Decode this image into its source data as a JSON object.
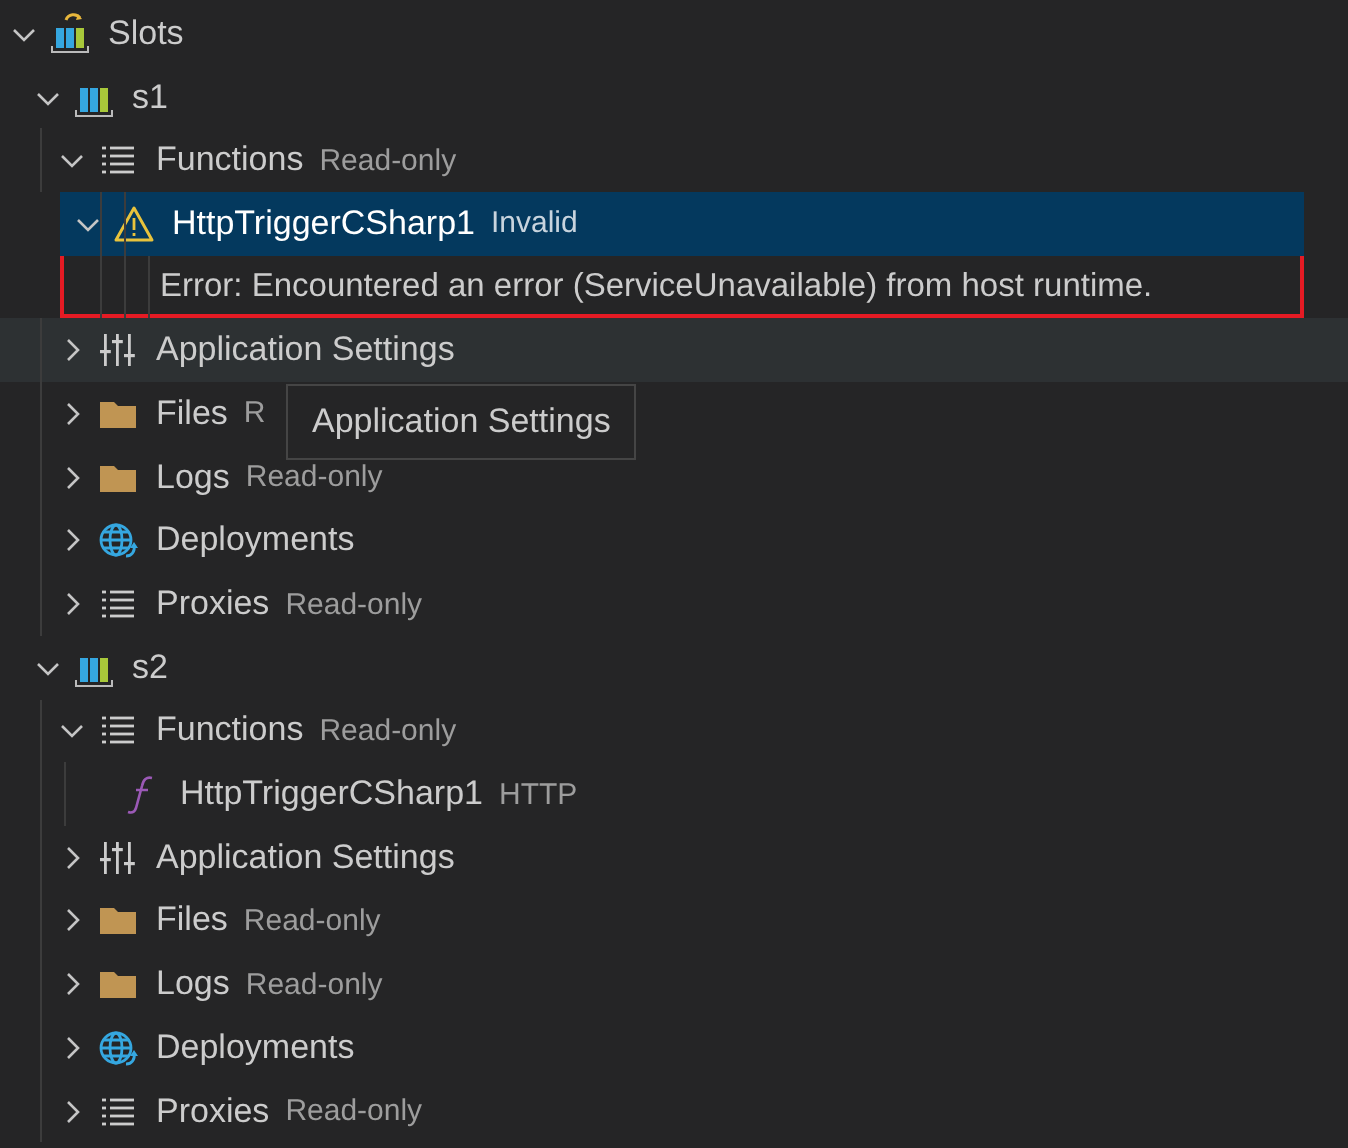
{
  "tree": [
    {
      "kind": "slots",
      "label": "Slots",
      "expanded": true,
      "children": [
        {
          "kind": "slot",
          "label": "s1",
          "expanded": true,
          "children": [
            {
              "kind": "list",
              "label": "Functions",
              "description": "Read-only",
              "expanded": true,
              "children": [
                {
                  "kind": "warning",
                  "label": "HttpTriggerCSharp1",
                  "description": "Invalid",
                  "expanded": true,
                  "selected": true,
                  "outlined": true,
                  "children": [
                    {
                      "kind": "message",
                      "label": "Error: Encountered an error (ServiceUnavailable) from host runtime."
                    }
                  ]
                }
              ]
            },
            {
              "kind": "settings",
              "label": "Application Settings",
              "expanded": false,
              "hovered": true,
              "tooltip": "Application Settings"
            },
            {
              "kind": "folder",
              "label": "Files",
              "description": "R",
              "expanded": false
            },
            {
              "kind": "folder",
              "label": "Logs",
              "description": "Read-only",
              "expanded": false
            },
            {
              "kind": "globe",
              "label": "Deployments",
              "expanded": false
            },
            {
              "kind": "list",
              "label": "Proxies",
              "description": "Read-only",
              "expanded": false
            }
          ]
        },
        {
          "kind": "slot",
          "label": "s2",
          "expanded": true,
          "children": [
            {
              "kind": "list",
              "label": "Functions",
              "description": "Read-only",
              "expanded": true,
              "children": [
                {
                  "kind": "function",
                  "label": "HttpTriggerCSharp1",
                  "description": "HTTP"
                }
              ]
            },
            {
              "kind": "settings",
              "label": "Application Settings",
              "expanded": false
            },
            {
              "kind": "folder",
              "label": "Files",
              "description": "Read-only",
              "expanded": false
            },
            {
              "kind": "folder",
              "label": "Logs",
              "description": "Read-only",
              "expanded": false
            },
            {
              "kind": "globe",
              "label": "Deployments",
              "expanded": false
            },
            {
              "kind": "list",
              "label": "Proxies",
              "description": "Read-only",
              "expanded": false
            }
          ]
        }
      ]
    }
  ]
}
